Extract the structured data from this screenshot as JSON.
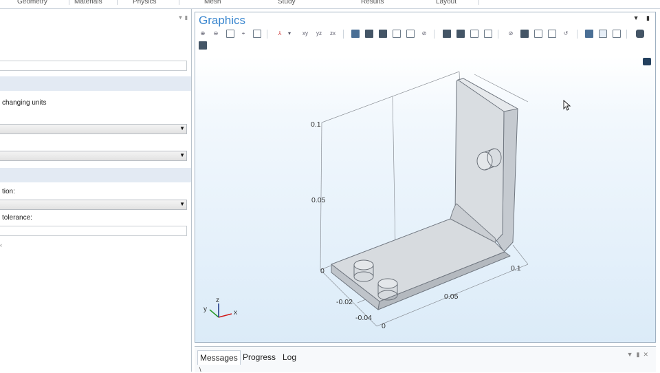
{
  "ribbon": {
    "tabs": [
      "Geometry",
      "Materials",
      "Physics",
      "Mesh",
      "Study",
      "Results",
      "Layout"
    ]
  },
  "left_panel": {
    "text_units": "changing units",
    "text_option": "tion:",
    "text_tolerance": "tolerance:",
    "selects": [
      "",
      "",
      ""
    ]
  },
  "graphics": {
    "title": "Graphics",
    "toolbar_icons": [
      "zoom-in-icon",
      "zoom-out-icon",
      "zoom-box-icon",
      "zoom-extents-icon",
      "zoom-selected-icon",
      "go-to-view-icon",
      "view-xy-icon",
      "view-yz-icon",
      "view-zx-icon",
      "scene-light-icon",
      "transparency-icon",
      "wireframe-icon",
      "render-mode-icon",
      "grid-icon",
      "hide-icon",
      "select-domains-icon",
      "select-boundaries-icon",
      "select-edges-icon",
      "select-points-icon",
      "hide-selected-icon",
      "view-all-icon",
      "reset-hiding-icon",
      "reset-view-icon",
      "undo-view-icon",
      "panel-left-icon",
      "panel-center-icon",
      "panel-right-icon",
      "screenshot-icon",
      "print-icon"
    ],
    "axis_ticks": {
      "z": [
        "0.1",
        "0.05",
        "0"
      ],
      "y": [
        "-0.02",
        "-0.04"
      ],
      "x": [
        "0",
        "0.05",
        "0.1"
      ]
    },
    "triad_labels": {
      "x": "x",
      "y": "y",
      "z": "z"
    },
    "colors": {
      "title": "#3b87cf",
      "x_axis": "#d11a1a",
      "y_axis": "#2a9b2a",
      "z_axis": "#1f3a8a"
    }
  },
  "messages": {
    "tabs": [
      "Messages",
      "Progress",
      "Log"
    ],
    "active_tab": "Messages",
    "console_text": "\\"
  }
}
